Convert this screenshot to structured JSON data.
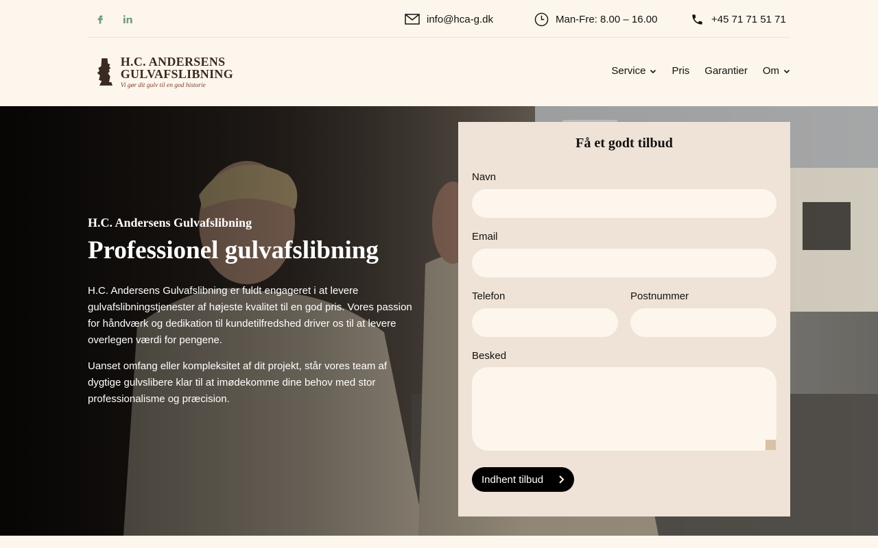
{
  "topbar": {
    "social": [
      "facebook-icon",
      "linkedin-icon"
    ],
    "email": "info@hca-g.dk",
    "hours": "Man-Fre: 8.00 – 16.00",
    "phone": "+45 71 71 51 71"
  },
  "logo": {
    "line1": "H.C. ANDERSENS",
    "line2": "GULVAFSLIBNING",
    "tagline": "Vi gør dit gulv til en god historie"
  },
  "nav": {
    "items": [
      {
        "label": "Service",
        "dropdown": true
      },
      {
        "label": "Pris",
        "dropdown": false
      },
      {
        "label": "Garantier",
        "dropdown": false
      },
      {
        "label": "Om",
        "dropdown": true
      }
    ]
  },
  "hero": {
    "subtitle": "H.C. Andersens Gulvafslibning",
    "title": "Professionel gulvafslibning",
    "paragraph1": "H.C. Andersens Gulvafslibning er fuldt engageret i at levere gulvafslibningstjenester af højeste kvalitet til en god pris. Vores passion for håndværk og dedikation til kundetilfredshed driver os til at levere overlegen værdi for pengene.",
    "paragraph2": "Uanset omfang eller kompleksitet af dit projekt, står vores team af dygtige gulvslibere klar til at imødekomme dine behov med stor professionalisme og præcision."
  },
  "form": {
    "title": "Få et godt tilbud",
    "name_label": "Navn",
    "email_label": "Email",
    "phone_label": "Telefon",
    "zip_label": "Postnummer",
    "message_label": "Besked",
    "submit_label": "Indhent tilbud"
  },
  "colors": {
    "page_bg": "#fdf6ec",
    "form_bg": "#eee3d6",
    "social": "#6f9a8b",
    "button": "#000000"
  }
}
